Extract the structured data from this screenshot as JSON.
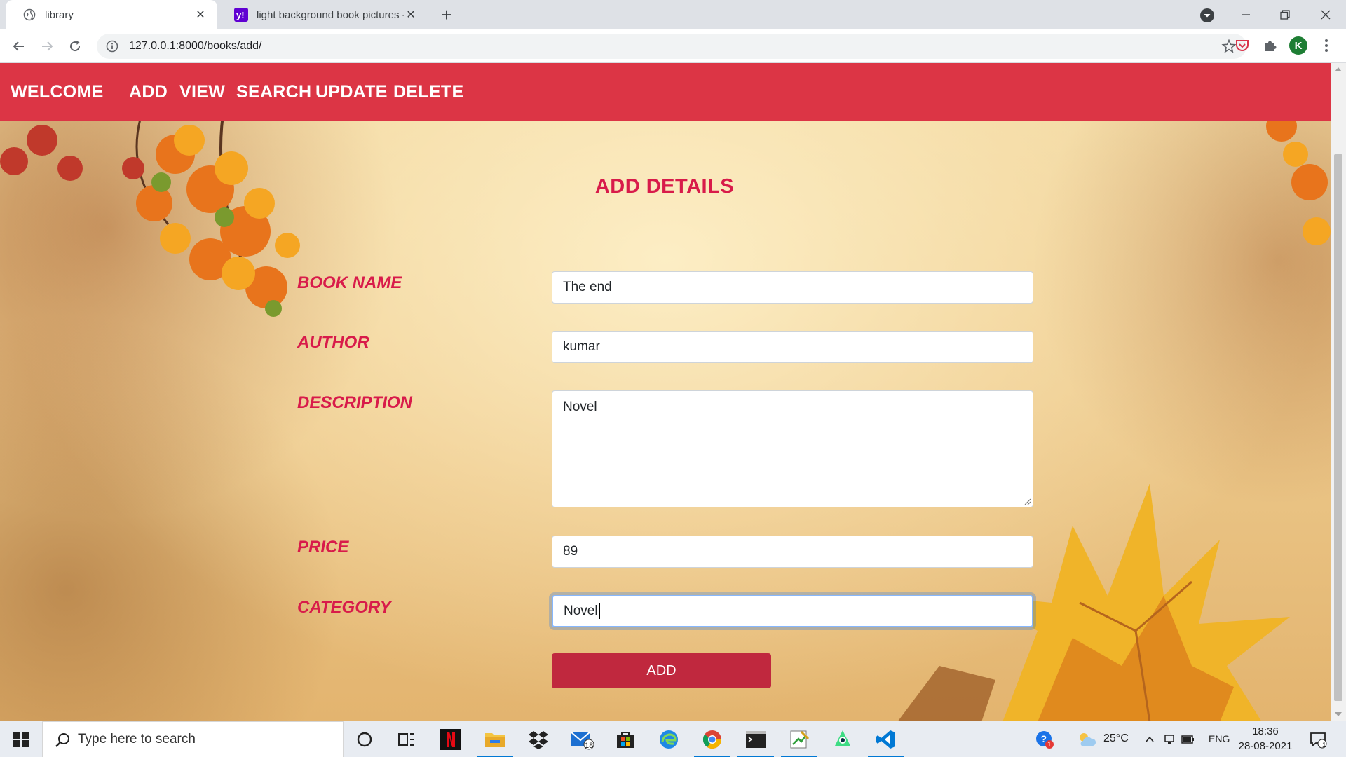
{
  "browser": {
    "tabs": [
      {
        "title": "library",
        "icon": "globe-icon",
        "active": true
      },
      {
        "title": "light background book pictures -",
        "icon": "yahoo-icon",
        "active": false
      }
    ],
    "url": "127.0.0.1:8000/books/add/",
    "profile_initial": "K"
  },
  "navbar": {
    "brand": "WELCOME",
    "links": [
      "ADD",
      "VIEW",
      "SEARCH",
      "UPDATE",
      "DELETE"
    ],
    "color": "#dc3545"
  },
  "form": {
    "title": "ADD DETAILS",
    "fields": [
      {
        "label": "BOOK NAME",
        "value": "The end"
      },
      {
        "label": "AUTHOR",
        "value": "kumar"
      },
      {
        "label": "DESCRIPTION",
        "value": "Novel"
      },
      {
        "label": "PRICE",
        "value": "89"
      },
      {
        "label": "CATEGORY",
        "value": "Novel"
      }
    ],
    "submit_label": "ADD",
    "label_color": "#d81b4a",
    "button_color": "#c0283e"
  },
  "taskbar": {
    "search_placeholder": "Type here to search",
    "mail_badge": "18",
    "help_badge": "1",
    "weather": "25°C",
    "language": "ENG",
    "time": "18:36",
    "date": "28-08-2021",
    "notification_count": "1"
  }
}
